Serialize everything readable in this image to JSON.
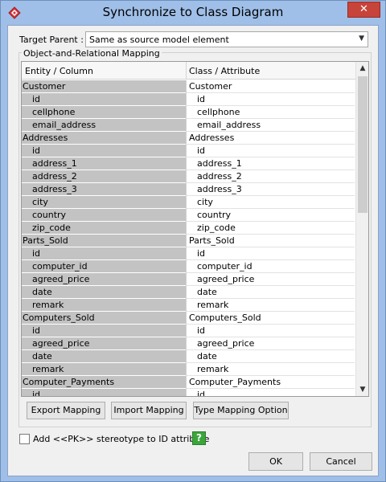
{
  "window": {
    "title": "Synchronize to Class Diagram",
    "close_symbol": "✕"
  },
  "target_parent": {
    "label": "Target Parent :",
    "value": "Same as source model element",
    "arrow": "▼"
  },
  "mapping_group": {
    "legend": "Object-and-Relational Mapping",
    "headers": {
      "left": "Entity / Column",
      "right": "Class / Attribute"
    },
    "rows": [
      {
        "kind": "table",
        "left": "Customer",
        "right": "Customer"
      },
      {
        "kind": "column",
        "left": "id",
        "right": "id"
      },
      {
        "kind": "column",
        "left": "cellphone",
        "right": "cellphone"
      },
      {
        "kind": "column",
        "left": "email_address",
        "right": "email_address"
      },
      {
        "kind": "table",
        "left": "Addresses",
        "right": "Addresses"
      },
      {
        "kind": "column",
        "left": "id",
        "right": "id"
      },
      {
        "kind": "column",
        "left": "address_1",
        "right": "address_1"
      },
      {
        "kind": "column",
        "left": "address_2",
        "right": "address_2"
      },
      {
        "kind": "column",
        "left": "address_3",
        "right": "address_3"
      },
      {
        "kind": "column",
        "left": "city",
        "right": "city"
      },
      {
        "kind": "column",
        "left": "country",
        "right": "country"
      },
      {
        "kind": "column",
        "left": "zip_code",
        "right": "zip_code"
      },
      {
        "kind": "table",
        "left": "Parts_Sold",
        "right": "Parts_Sold"
      },
      {
        "kind": "column",
        "left": "id",
        "right": "id"
      },
      {
        "kind": "column",
        "left": "computer_id",
        "right": "computer_id"
      },
      {
        "kind": "column",
        "left": "agreed_price",
        "right": "agreed_price"
      },
      {
        "kind": "column",
        "left": "date",
        "right": "date"
      },
      {
        "kind": "column",
        "left": "remark",
        "right": "remark"
      },
      {
        "kind": "table",
        "left": "Computers_Sold",
        "right": "Computers_Sold"
      },
      {
        "kind": "column",
        "left": "id",
        "right": "id"
      },
      {
        "kind": "column",
        "left": "agreed_price",
        "right": "agreed_price"
      },
      {
        "kind": "column",
        "left": "date",
        "right": "date"
      },
      {
        "kind": "column",
        "left": "remark",
        "right": "remark"
      },
      {
        "kind": "table",
        "left": "Computer_Payments",
        "right": "Computer_Payments"
      },
      {
        "kind": "column",
        "left": "id",
        "right": "id"
      }
    ],
    "scroll": {
      "up": "▲",
      "down": "▼"
    }
  },
  "buttons": {
    "export": "Export Mapping",
    "import": "Import Mapping",
    "type_option": "Type Mapping Option",
    "ok": "OK",
    "cancel": "Cancel"
  },
  "stereotype_option": {
    "label": "Add <<PK>> stereotype to ID attribute",
    "checked": false,
    "help": "?"
  },
  "colors": {
    "title_bar": "#9fbfe8",
    "close_button": "#c7443a",
    "entity_cell": "#c3c3c3",
    "help_icon": "#3aa63a"
  }
}
